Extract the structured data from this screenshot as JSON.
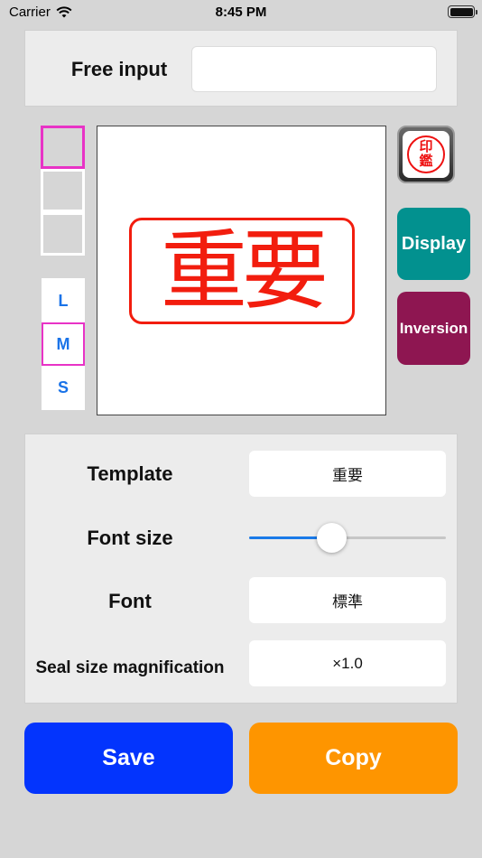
{
  "status_bar": {
    "carrier": "Carrier",
    "time": "8:45 PM"
  },
  "free_input": {
    "label": "Free input",
    "value": ""
  },
  "colors": {
    "swatches": [
      "#ff2d00",
      "#0233ff",
      "#000000"
    ],
    "selected_index": 0,
    "selection_border": "#e833c6"
  },
  "sizes": {
    "items": [
      "L",
      "M",
      "S"
    ],
    "selected": "M"
  },
  "preview": {
    "stamp_text": "重要",
    "stamp_color": "#f21d0e"
  },
  "seal_button": {
    "line1": "印",
    "line2": "鑑"
  },
  "display_button": {
    "label": "Display",
    "color": "#02918f"
  },
  "inversion_button": {
    "label": "Inversion",
    "color": "#8e1651"
  },
  "settings": {
    "template_label": "Template",
    "template_value": "重要",
    "font_size_label": "Font size",
    "font_size_level": 0.42,
    "font_label": "Font",
    "font_value": "標準",
    "seal_size_label": "Seal size magnification",
    "seal_size_value": "×1.0"
  },
  "actions": {
    "save_label": "Save",
    "copy_label": "Copy",
    "save_color": "#0334fd",
    "copy_color": "#fe9500"
  }
}
